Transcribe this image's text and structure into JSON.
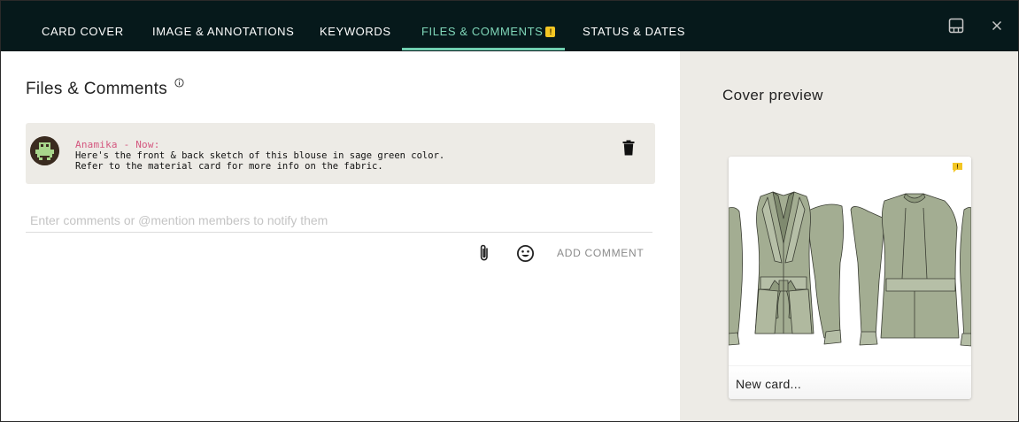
{
  "tabs": [
    {
      "label": "CARD COVER",
      "active": false
    },
    {
      "label": "IMAGE & ANNOTATIONS",
      "active": false
    },
    {
      "label": "KEYWORDS",
      "active": false
    },
    {
      "label": "FILES & COMMENTS",
      "active": true,
      "badge": "!"
    },
    {
      "label": "STATUS & DATES",
      "active": false
    }
  ],
  "toolbar": {
    "layout_icon": "panel-layout-icon",
    "close_icon": "close-icon"
  },
  "files_comments": {
    "title": "Files & Comments",
    "info_icon": "info-icon",
    "comments": [
      {
        "author": "Anamika - Now:",
        "lines": [
          "Here's the front & back sketch of this blouse in sage green color.",
          "Refer to the material card for more info on the fabric."
        ]
      }
    ],
    "input_placeholder": "Enter comments or @mention members to notify them",
    "input_value": "",
    "add_comment_label": "ADD COMMENT"
  },
  "cover_preview": {
    "title": "Cover preview",
    "card_label": "New card...",
    "badge": "!"
  },
  "colors": {
    "topbar": "#06191b",
    "active_tab": "#7fd6b8",
    "author": "#d4577f",
    "badge": "#f3c623",
    "sage": "#a3ad92",
    "panel_bg": "#edebe6"
  }
}
